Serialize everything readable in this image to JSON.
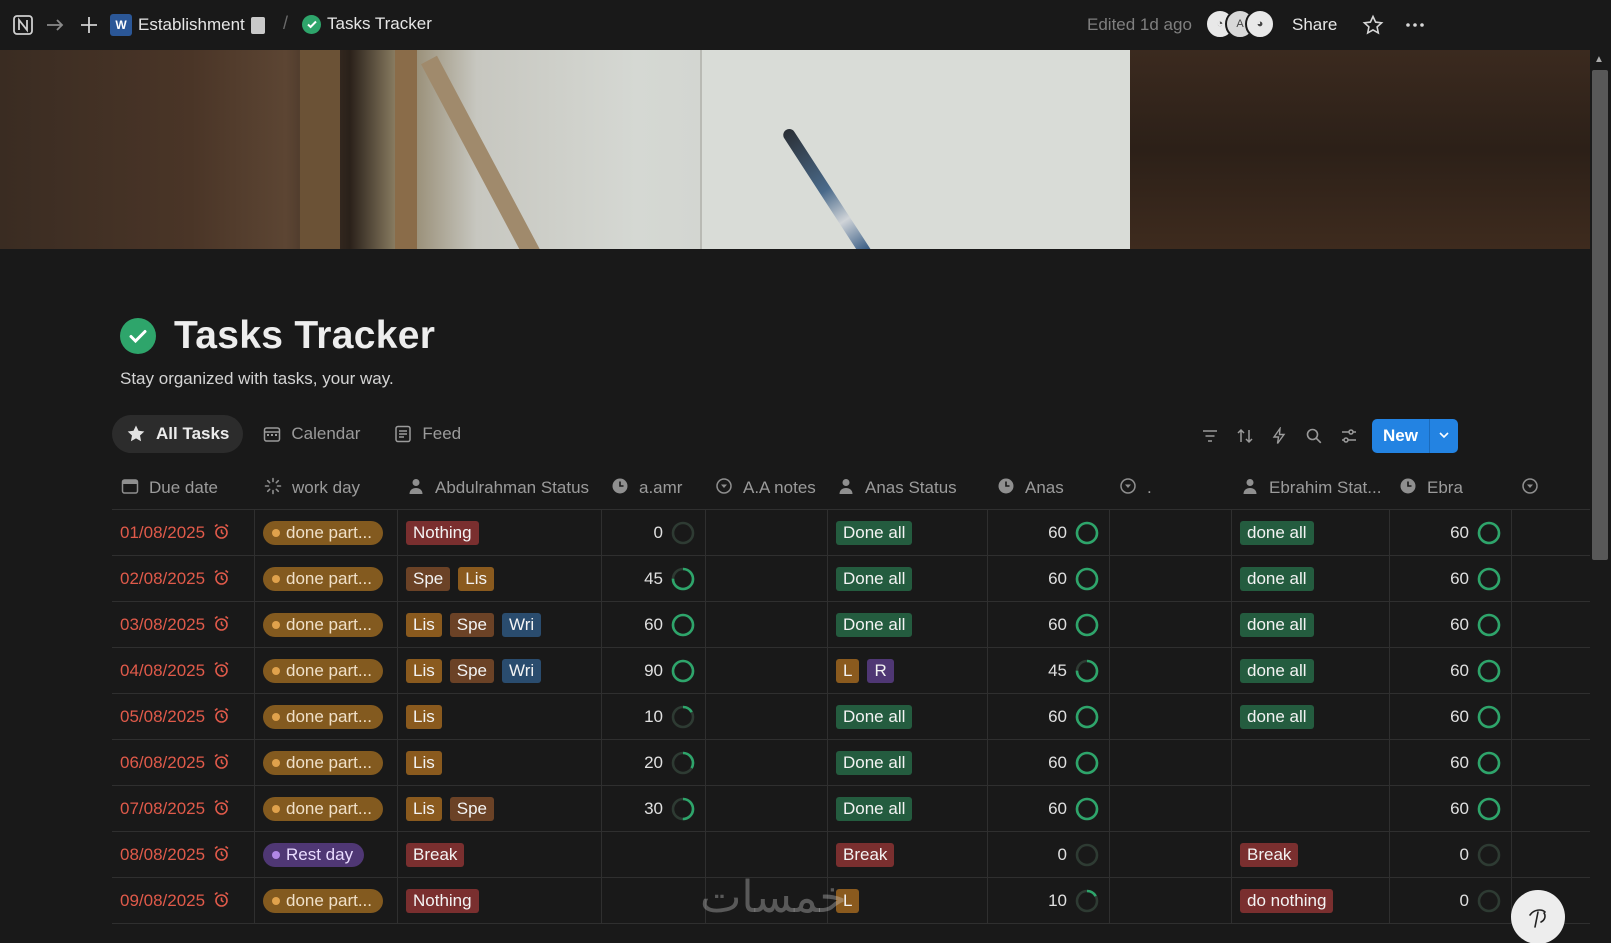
{
  "topbar": {
    "breadcrumb_parent": "Establishment",
    "breadcrumb_current": "Tasks Tracker",
    "edited": "Edited 1d ago",
    "share_label": "Share",
    "avatar_letter": "A"
  },
  "page": {
    "title": "Tasks Tracker",
    "subtitle": "Stay organized with tasks, your way."
  },
  "views": [
    {
      "label": "All Tasks",
      "icon": "star-icon",
      "active": true
    },
    {
      "label": "Calendar",
      "icon": "calendar-icon",
      "active": false
    },
    {
      "label": "Feed",
      "icon": "feed-icon",
      "active": false
    }
  ],
  "toolbar": {
    "new_label": "New"
  },
  "columns": [
    {
      "label": "Due date",
      "icon": "calendar-icon"
    },
    {
      "label": "work day",
      "icon": "loading-icon"
    },
    {
      "label": "Abdulrahman Status",
      "icon": "person-icon"
    },
    {
      "label": "a.amr",
      "icon": "clock-icon"
    },
    {
      "label": "A.A notes",
      "icon": "select-icon"
    },
    {
      "label": "Anas Status",
      "icon": "person-icon"
    },
    {
      "label": "Anas",
      "icon": "clock-icon"
    },
    {
      "label": ".",
      "icon": "select-icon"
    },
    {
      "label": "Ebrahim Stat...",
      "icon": "person-icon"
    },
    {
      "label": "Ebra",
      "icon": "clock-icon"
    }
  ],
  "rows": [
    {
      "date": "01/08/2025",
      "workday": "done part...",
      "workday_type": "part",
      "ab_tags": [
        {
          "t": "Nothing",
          "c": "red"
        }
      ],
      "aamr": "0",
      "anas_tags": [
        {
          "t": "Done all",
          "c": "green"
        }
      ],
      "anas": "60",
      "eb_tags": [
        {
          "t": "done all",
          "c": "green"
        }
      ],
      "ebra": "60"
    },
    {
      "date": "02/08/2025",
      "workday": "done part...",
      "workday_type": "part",
      "ab_tags": [
        {
          "t": "Spe",
          "c": "brown"
        },
        {
          "t": "Lis",
          "c": "orange"
        }
      ],
      "aamr": "45",
      "anas_tags": [
        {
          "t": "Done all",
          "c": "green"
        }
      ],
      "anas": "60",
      "eb_tags": [
        {
          "t": "done all",
          "c": "green"
        }
      ],
      "ebra": "60"
    },
    {
      "date": "03/08/2025",
      "workday": "done part...",
      "workday_type": "part",
      "ab_tags": [
        {
          "t": "Lis",
          "c": "orange"
        },
        {
          "t": "Spe",
          "c": "brown"
        },
        {
          "t": "Wri",
          "c": "blue"
        }
      ],
      "aamr": "60",
      "anas_tags": [
        {
          "t": "Done all",
          "c": "green"
        }
      ],
      "anas": "60",
      "eb_tags": [
        {
          "t": "done all",
          "c": "green"
        }
      ],
      "ebra": "60"
    },
    {
      "date": "04/08/2025",
      "workday": "done part...",
      "workday_type": "part",
      "ab_tags": [
        {
          "t": "Lis",
          "c": "orange"
        },
        {
          "t": "Spe",
          "c": "brown"
        },
        {
          "t": "Wri",
          "c": "blue"
        }
      ],
      "aamr": "90",
      "anas_tags": [
        {
          "t": "L",
          "c": "orange"
        },
        {
          "t": "R",
          "c": "purple"
        }
      ],
      "anas": "45",
      "eb_tags": [
        {
          "t": "done all",
          "c": "green"
        }
      ],
      "ebra": "60"
    },
    {
      "date": "05/08/2025",
      "workday": "done part...",
      "workday_type": "part",
      "ab_tags": [
        {
          "t": "Lis",
          "c": "orange"
        }
      ],
      "aamr": "10",
      "anas_tags": [
        {
          "t": "Done all",
          "c": "green"
        }
      ],
      "anas": "60",
      "eb_tags": [
        {
          "t": "done all",
          "c": "green"
        }
      ],
      "ebra": "60"
    },
    {
      "date": "06/08/2025",
      "workday": "done part...",
      "workday_type": "part",
      "ab_tags": [
        {
          "t": "Lis",
          "c": "orange"
        }
      ],
      "aamr": "20",
      "anas_tags": [
        {
          "t": "Done all",
          "c": "green"
        }
      ],
      "anas": "60",
      "eb_tags": [],
      "ebra": "60"
    },
    {
      "date": "07/08/2025",
      "workday": "done part...",
      "workday_type": "part",
      "ab_tags": [
        {
          "t": "Lis",
          "c": "orange"
        },
        {
          "t": "Spe",
          "c": "brown"
        }
      ],
      "aamr": "30",
      "anas_tags": [
        {
          "t": "Done all",
          "c": "green"
        }
      ],
      "anas": "60",
      "eb_tags": [],
      "ebra": "60"
    },
    {
      "date": "08/08/2025",
      "workday": "Rest day",
      "workday_type": "rest",
      "ab_tags": [
        {
          "t": "Break",
          "c": "red"
        }
      ],
      "aamr": "",
      "anas_tags": [
        {
          "t": "Break",
          "c": "red"
        }
      ],
      "anas": "0",
      "eb_tags": [
        {
          "t": "Break",
          "c": "red"
        }
      ],
      "ebra": "0"
    },
    {
      "date": "09/08/2025",
      "workday": "done part...",
      "workday_type": "part",
      "ab_tags": [
        {
          "t": "Nothing",
          "c": "red"
        }
      ],
      "aamr": "",
      "anas_tags": [
        {
          "t": "L",
          "c": "orange"
        }
      ],
      "anas": "10",
      "eb_tags": [
        {
          "t": "do nothing",
          "c": "red"
        }
      ],
      "ebra": "0"
    }
  ],
  "colors": {
    "accent": "#2383e2",
    "ring_green": "#2ea56b",
    "date_red": "#e05a4a"
  }
}
